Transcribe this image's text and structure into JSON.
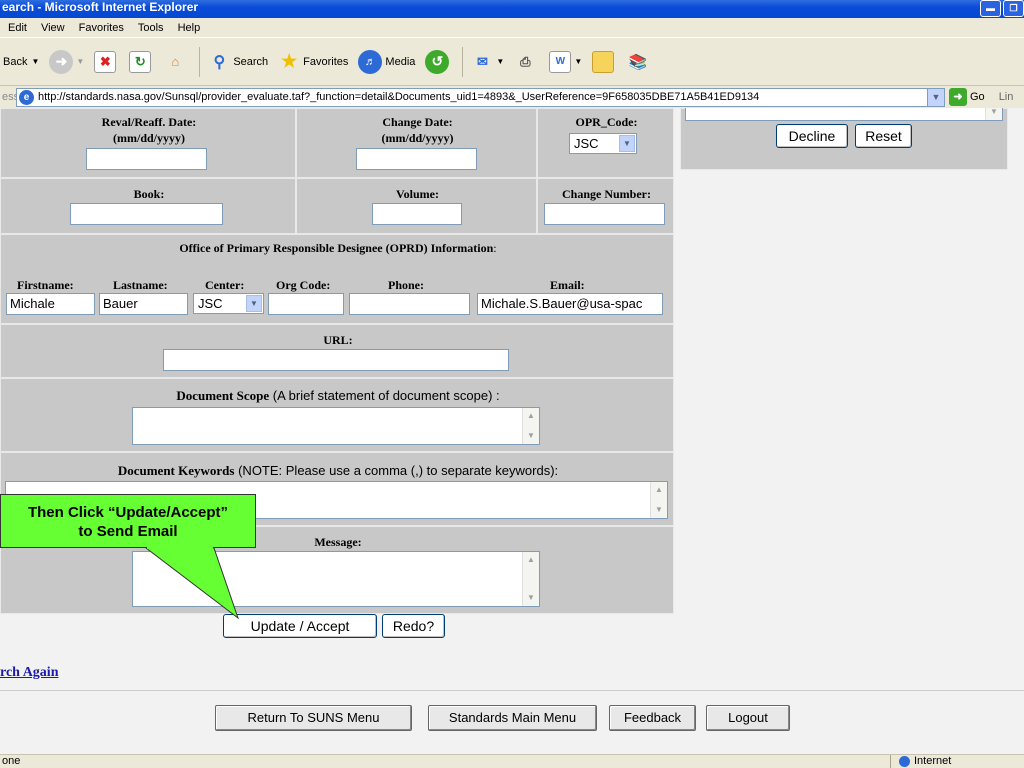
{
  "window": {
    "title": "earch - Microsoft Internet Explorer"
  },
  "menu": [
    "Edit",
    "View",
    "Favorites",
    "Tools",
    "Help"
  ],
  "toolbar": {
    "back": "Back",
    "search": "Search",
    "favorites": "Favorites",
    "media": "Media"
  },
  "address": {
    "label": "ess",
    "url": "http://standards.nasa.gov/Sunsql/provider_evaluate.taf?_function=detail&Documents_uid1=4893&_UserReference=9F658035DBE71A5B41ED9134",
    "go": "Go",
    "links": "Lin"
  },
  "form": {
    "reval_label": "Reval/Reaff. Date:",
    "reval_fmt": "(mm/dd/yyyy)",
    "change_label": "Change Date:",
    "change_fmt": "(mm/dd/yyyy)",
    "opr_label": "OPR_Code:",
    "opr_value": "JSC",
    "book_label": "Book:",
    "volume_label": "Volume:",
    "change_number_label": "Change Number:",
    "oprd_title": "Office of Primary Responsible Designee (OPRD) Information",
    "oprd_colon": ":",
    "firstname_label": "Firstname:",
    "lastname_label": "Lastname:",
    "center_label": "Center:",
    "orgcode_label": "Org Code:",
    "phone_label": "Phone:",
    "email_label": "Email:",
    "firstname_value": "Michale",
    "lastname_value": "Bauer",
    "center_value": "JSC",
    "email_value": "Michale.S.Bauer@usa-spac",
    "url_label": "URL:",
    "scope_label": "Document Scope",
    "scope_note": " (A brief statement of document scope) :",
    "keywords_label": "Document Keywords",
    "keywords_note": " (NOTE: Please use a comma (,) to separate keywords):",
    "message_label": "Message:",
    "update_button": "Update / Accept",
    "redo_button": "Redo?"
  },
  "right_panel": {
    "decline_button": "Decline",
    "reset_button": "Reset"
  },
  "callout": {
    "line1": "Then Click “Update/Accept”",
    "line2": "to Send Email"
  },
  "search_again": "rch Again",
  "footer": {
    "return": "Return To SUNS Menu",
    "standards": "Standards Main Menu",
    "feedback": "Feedback",
    "logout": "Logout"
  },
  "status": {
    "text": "one",
    "zone": "Internet"
  }
}
